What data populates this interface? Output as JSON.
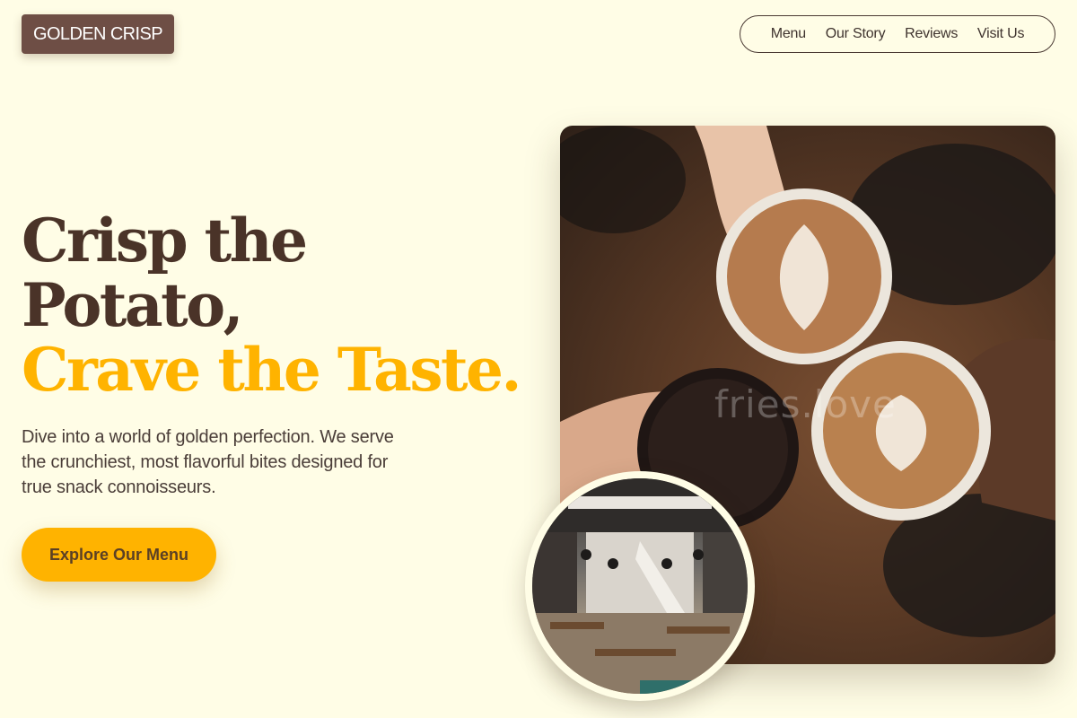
{
  "brand": {
    "logo_text": "GOLDEN CRISP"
  },
  "nav": {
    "items": [
      {
        "label": "Menu"
      },
      {
        "label": "Our Story"
      },
      {
        "label": "Reviews"
      },
      {
        "label": "Visit Us"
      }
    ]
  },
  "hero": {
    "headline_line1": "Crisp the",
    "headline_line2": "Potato,",
    "headline_accent": "Crave the Taste.",
    "description": "Dive into a world of golden perfection. We serve the crunchiest, most flavorful bites designed for true snack connoisseurs.",
    "cta_label": "Explore Our Menu"
  },
  "images": {
    "main_watermark": "fries.love",
    "main_photo_icon": "coffee-cups-photo",
    "inset_photo_icon": "cafe-interior-photo"
  },
  "colors": {
    "background": "#fffde6",
    "brand_brown": "#6e4e45",
    "accent": "#ffb300",
    "text_dark": "#4a3328"
  }
}
